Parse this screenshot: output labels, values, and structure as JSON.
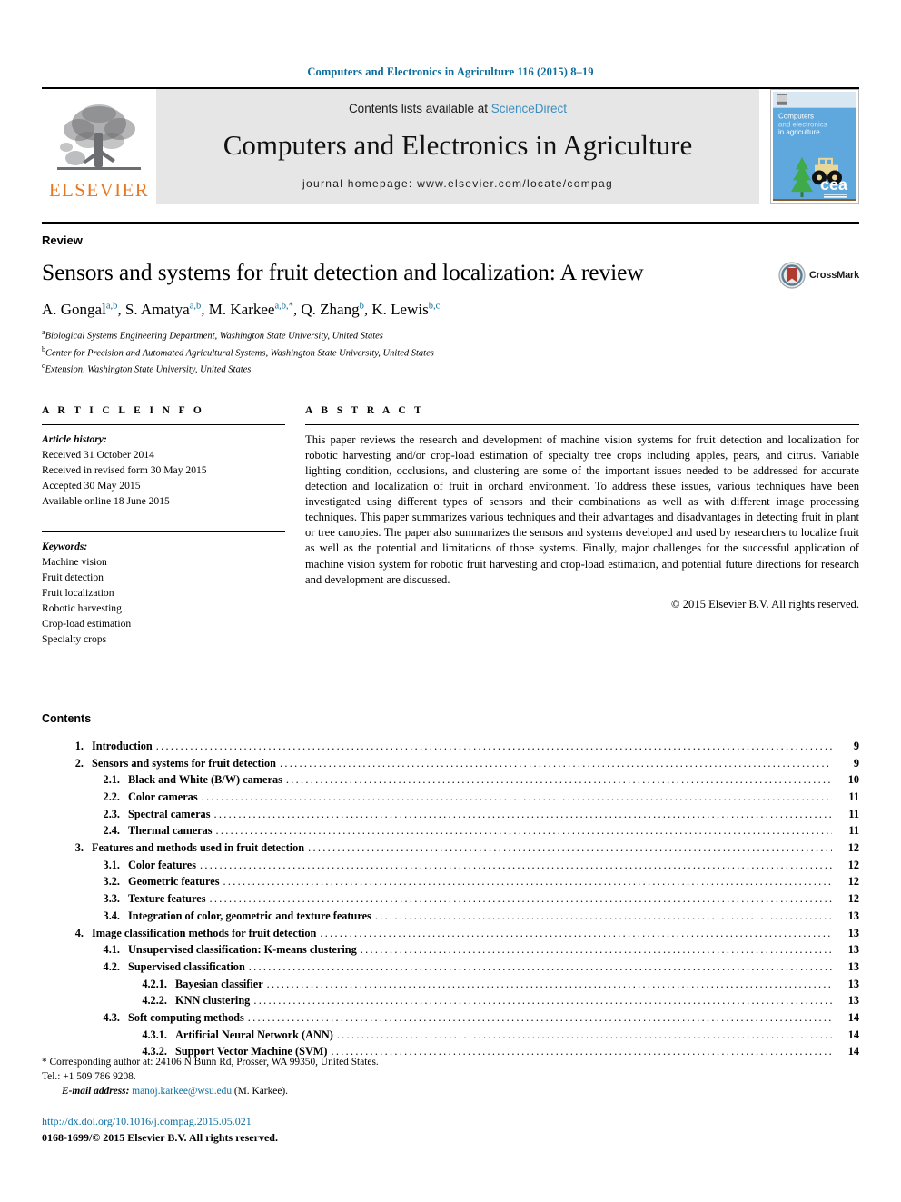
{
  "running_head": "Computers and Electronics in Agriculture 116 (2015) 8–19",
  "masthead": {
    "publisher_name": "ELSEVIER",
    "contents_prefix": "Contents lists available at ",
    "sciencedirect": "ScienceDirect",
    "journal_title": "Computers and Electronics in Agriculture",
    "homepage": "journal homepage: www.elsevier.com/locate/compag",
    "cover": {
      "line1": "Computers",
      "line2": "and electronics",
      "line3": "in agriculture",
      "logo_text": "cea",
      "bg_color": "#5fa8dd"
    }
  },
  "article": {
    "kicker": "Review",
    "title": "Sensors and systems for fruit detection and localization: A review",
    "crossmark_label": "CrossMark",
    "authors": [
      {
        "name": "A. Gongal",
        "sup": "a,b",
        "sep": ", "
      },
      {
        "name": "S. Amatya",
        "sup": "a,b",
        "sep": ", "
      },
      {
        "name": "M. Karkee",
        "sup": "a,b,*",
        "sep": ", "
      },
      {
        "name": "Q. Zhang",
        "sup": "b",
        "sep": ", "
      },
      {
        "name": "K. Lewis",
        "sup": "b,c",
        "sep": ""
      }
    ],
    "affiliations": [
      {
        "mark": "a",
        "text": "Biological Systems Engineering Department, Washington State University, United States"
      },
      {
        "mark": "b",
        "text": "Center for Precision and Automated Agricultural Systems, Washington State University, United States"
      },
      {
        "mark": "c",
        "text": "Extension, Washington State University, United States"
      }
    ]
  },
  "article_info": {
    "heading": "A R T I C L E   I N F O",
    "history_label": "Article history:",
    "history": [
      "Received 31 October 2014",
      "Received in revised form 30 May 2015",
      "Accepted 30 May 2015",
      "Available online 18 June 2015"
    ],
    "keywords_label": "Keywords:",
    "keywords": [
      "Machine vision",
      "Fruit detection",
      "Fruit localization",
      "Robotic harvesting",
      "Crop-load estimation",
      "Specialty crops"
    ]
  },
  "abstract": {
    "heading": "A B S T R A C T",
    "text": "This paper reviews the research and development of machine vision systems for fruit detection and localization for robotic harvesting and/or crop-load estimation of specialty tree crops including apples, pears, and citrus. Variable lighting condition, occlusions, and clustering are some of the important issues needed to be addressed for accurate detection and localization of fruit in orchard environment. To address these issues, various techniques have been investigated using different types of sensors and their combinations as well as with different image processing techniques. This paper summarizes various techniques and their advantages and disadvantages in detecting fruit in plant or tree canopies. The paper also summarizes the sensors and systems developed and used by researchers to localize fruit as well as the potential and limitations of those systems. Finally, major challenges for the successful application of machine vision system for robotic fruit harvesting and crop-load estimation, and potential future directions for research and development are discussed.",
    "copyright": "© 2015 Elsevier B.V. All rights reserved."
  },
  "contents": {
    "title": "Contents",
    "entries": [
      {
        "level": 1,
        "num": "1.",
        "label": "Introduction",
        "page": "9"
      },
      {
        "level": 1,
        "num": "2.",
        "label": "Sensors and systems for fruit detection",
        "page": "9"
      },
      {
        "level": 2,
        "num": "2.1.",
        "label": "Black and White (B/W) cameras",
        "page": "10"
      },
      {
        "level": 2,
        "num": "2.2.",
        "label": "Color cameras",
        "page": "11"
      },
      {
        "level": 2,
        "num": "2.3.",
        "label": "Spectral cameras",
        "page": "11"
      },
      {
        "level": 2,
        "num": "2.4.",
        "label": "Thermal cameras",
        "page": "11"
      },
      {
        "level": 1,
        "num": "3.",
        "label": "Features and methods used in fruit detection",
        "page": "12"
      },
      {
        "level": 2,
        "num": "3.1.",
        "label": "Color features",
        "page": "12"
      },
      {
        "level": 2,
        "num": "3.2.",
        "label": "Geometric features",
        "page": "12"
      },
      {
        "level": 2,
        "num": "3.3.",
        "label": "Texture features",
        "page": "12"
      },
      {
        "level": 2,
        "num": "3.4.",
        "label": "Integration of color, geometric and texture features",
        "page": "13"
      },
      {
        "level": 1,
        "num": "4.",
        "label": "Image classification methods for fruit detection",
        "page": "13"
      },
      {
        "level": 2,
        "num": "4.1.",
        "label": "Unsupervised classification: K-means clustering",
        "page": "13"
      },
      {
        "level": 2,
        "num": "4.2.",
        "label": "Supervised classification",
        "page": "13"
      },
      {
        "level": 3,
        "num": "4.2.1.",
        "label": "Bayesian classifier",
        "page": "13"
      },
      {
        "level": 3,
        "num": "4.2.2.",
        "label": "KNN clustering",
        "page": "13"
      },
      {
        "level": 2,
        "num": "4.3.",
        "label": "Soft computing methods",
        "page": "14"
      },
      {
        "level": 3,
        "num": "4.3.1.",
        "label": "Artificial Neural Network (ANN)",
        "page": "14"
      },
      {
        "level": 3,
        "num": "4.3.2.",
        "label": "Support Vector Machine (SVM)",
        "page": "14"
      }
    ]
  },
  "footer": {
    "corresponding_line1": "* Corresponding author at: 24106 N Bunn Rd, Prosser, WA 99350, United States.",
    "corresponding_line2": "Tel.: +1 509 786 9208.",
    "email_label": "E-mail address:",
    "email": "manoj.karkee@wsu.edu",
    "email_suffix": "(M. Karkee).",
    "doi": "http://dx.doi.org/10.1016/j.compag.2015.05.021",
    "issn": "0168-1699/© 2015 Elsevier B.V. All rights reserved."
  }
}
